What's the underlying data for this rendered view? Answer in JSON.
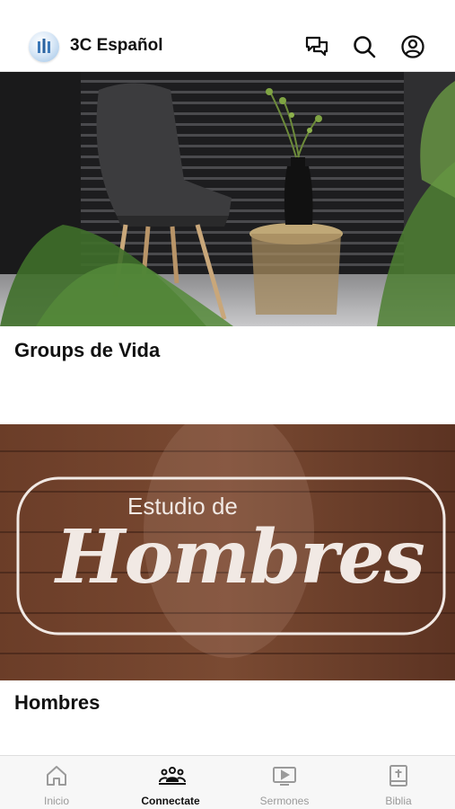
{
  "header": {
    "title": "3C Español",
    "icons": [
      "logo",
      "chat-icon",
      "search-icon",
      "account-icon"
    ]
  },
  "cards": [
    {
      "title": "Groups de Vida"
    },
    {
      "title": "Hombres",
      "banner": {
        "line1": "Estudio de",
        "line2": "Hombres"
      }
    }
  ],
  "tabbar": {
    "tabs": [
      {
        "label": "Inicio",
        "icon": "home-icon",
        "active": false
      },
      {
        "label": "Connectate",
        "icon": "people-icon",
        "active": true
      },
      {
        "label": "Sermones",
        "icon": "play-screen-icon",
        "active": false
      },
      {
        "label": "Biblia",
        "icon": "bible-icon",
        "active": false
      }
    ]
  },
  "colors": {
    "active_tab": "#111111",
    "inactive_tab": "#9a9a9a",
    "banner_text": "#f1e9e4"
  }
}
